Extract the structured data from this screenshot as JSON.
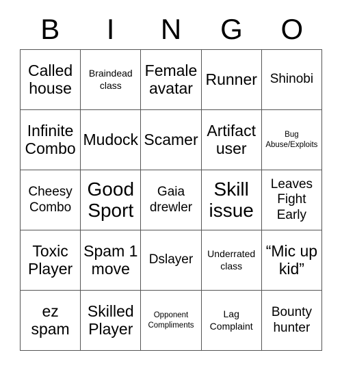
{
  "card": {
    "title_letters": [
      "B",
      "I",
      "N",
      "G",
      "O"
    ],
    "columns": 5,
    "rows": 5,
    "colors": {
      "text": "#000000",
      "border": "#555555",
      "background": "#ffffff"
    },
    "cells": [
      {
        "text": "Called house",
        "size": "fs-l"
      },
      {
        "text": "Braindead class",
        "size": "fs-s"
      },
      {
        "text": "Female avatar",
        "size": "fs-l"
      },
      {
        "text": "Runner",
        "size": "fs-l"
      },
      {
        "text": "Shinobi",
        "size": "fs-m"
      },
      {
        "text": "Infinite Combo",
        "size": "fs-l"
      },
      {
        "text": "Mudock",
        "size": "fs-l"
      },
      {
        "text": "Scamer",
        "size": "fs-l"
      },
      {
        "text": "Artifact user",
        "size": "fs-l"
      },
      {
        "text": "Bug Abuse/Exploits",
        "size": "fs-xs"
      },
      {
        "text": "Cheesy Combo",
        "size": "fs-m"
      },
      {
        "text": "Good Sport",
        "size": "fs-xl"
      },
      {
        "text": "Gaia drewler",
        "size": "fs-m"
      },
      {
        "text": "Skill issue",
        "size": "fs-xl"
      },
      {
        "text": "Leaves Fight Early",
        "size": "fs-m"
      },
      {
        "text": "Toxic Player",
        "size": "fs-l"
      },
      {
        "text": "Spam 1 move",
        "size": "fs-l"
      },
      {
        "text": "Dslayer",
        "size": "fs-m"
      },
      {
        "text": "Underrated class",
        "size": "fs-s"
      },
      {
        "text": "“Mic up kid”",
        "size": "fs-l"
      },
      {
        "text": "ez spam",
        "size": "fs-l"
      },
      {
        "text": "Skilled Player",
        "size": "fs-l"
      },
      {
        "text": "Opponent Compliments",
        "size": "fs-xs"
      },
      {
        "text": "Lag Complaint",
        "size": "fs-s"
      },
      {
        "text": "Bounty hunter",
        "size": "fs-m"
      }
    ]
  }
}
